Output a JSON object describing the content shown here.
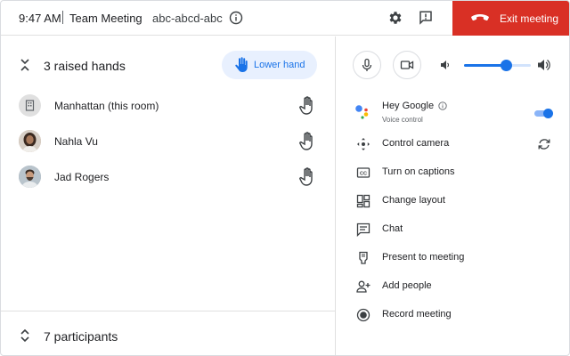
{
  "header": {
    "time": "9:47 AM",
    "meeting_title": "Team Meeting",
    "meeting_code": "abc-abcd-abc",
    "exit_label": "Exit meeting"
  },
  "raised_hands": {
    "title": "3 raised hands",
    "lower_label": "Lower hand",
    "people": [
      {
        "name": "Manhattan (this room)",
        "avatar": "room-icon"
      },
      {
        "name": "Nahla Vu",
        "avatar": "photo"
      },
      {
        "name": "Jad Rogers",
        "avatar": "photo"
      }
    ]
  },
  "participants": {
    "title": "7 participants"
  },
  "controls": {
    "volume_level": 0.63
  },
  "assistant": {
    "label": "Hey Google",
    "sublabel": "Voice control",
    "enabled": true
  },
  "menu": [
    {
      "label": "Control camera",
      "icon": "camera-control-icon"
    },
    {
      "label": "Turn on captions",
      "icon": "captions-icon"
    },
    {
      "label": "Change layout",
      "icon": "layout-icon"
    },
    {
      "label": "Chat",
      "icon": "chat-icon"
    },
    {
      "label": "Present to meeting",
      "icon": "present-icon"
    },
    {
      "label": "Add people",
      "icon": "add-people-icon"
    },
    {
      "label": "Record meeting",
      "icon": "record-icon"
    }
  ],
  "colors": {
    "exit_red": "#d93025",
    "accent_blue": "#1a73e8",
    "lower_bg": "#e8f0fe"
  }
}
